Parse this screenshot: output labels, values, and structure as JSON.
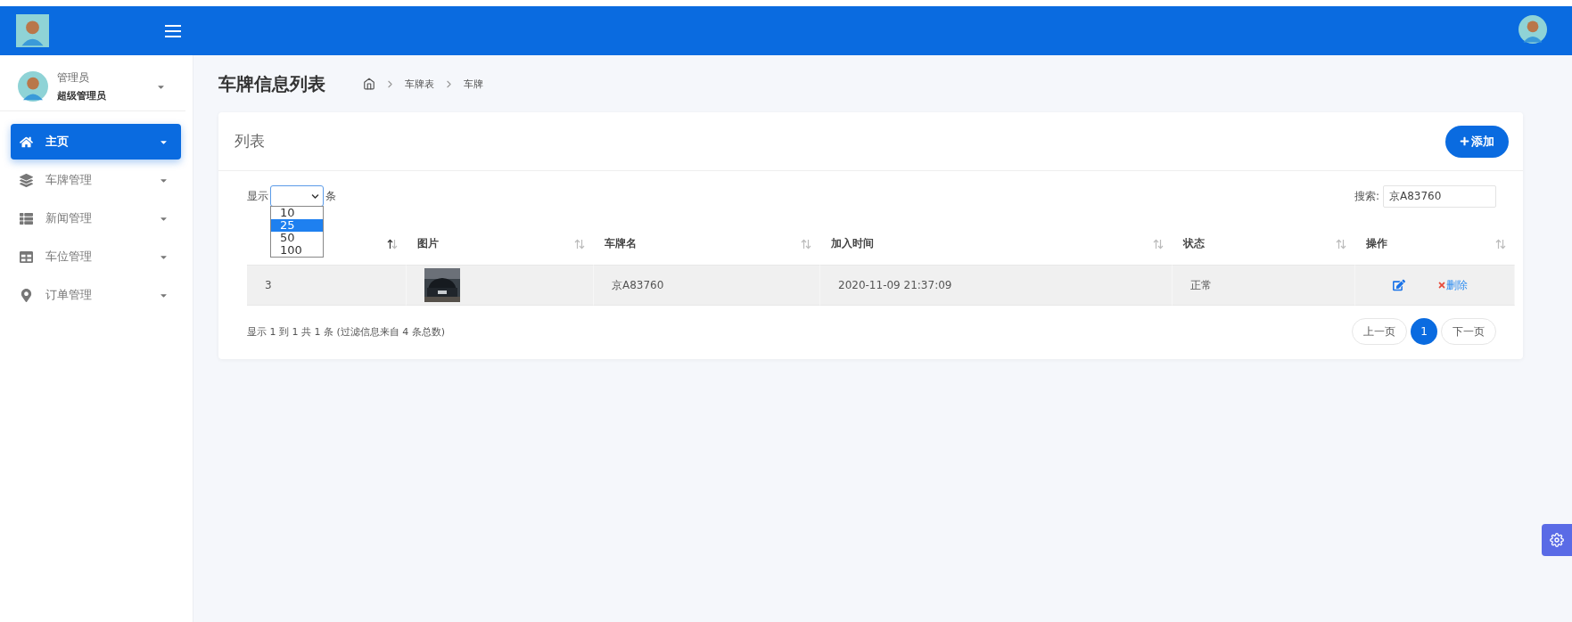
{
  "user": {
    "name": "管理员",
    "role": "超级管理员"
  },
  "menu": [
    {
      "label": "主页",
      "selected": true
    },
    {
      "label": "车牌管理",
      "selected": false
    },
    {
      "label": "新闻管理",
      "selected": false
    },
    {
      "label": "车位管理",
      "selected": false
    },
    {
      "label": "订单管理",
      "selected": false
    }
  ],
  "page_title": "车牌信息列表",
  "breadcrumb": [
    "车牌表",
    "车牌"
  ],
  "card": {
    "title": "列表",
    "add_button": "添加",
    "length": {
      "label_before": "显示",
      "label_after": "条",
      "expanded": true,
      "options": [
        {
          "label": "10",
          "selected": false
        },
        {
          "label": "25",
          "selected": true
        },
        {
          "label": "50",
          "selected": false
        },
        {
          "label": "100",
          "selected": false
        }
      ]
    },
    "search": {
      "label": "搜索:",
      "value": "京A83760"
    },
    "columns": [
      {
        "sorted": true
      },
      {
        "label": "图片",
        "sorted": false
      },
      {
        "label": "车牌名",
        "sorted": false
      },
      {
        "label": "加入时间",
        "sorted": false
      },
      {
        "label": "状态",
        "sorted": false
      },
      {
        "label": "操作",
        "sorted": false
      }
    ],
    "rows": [
      {
        "index": "3",
        "plate": "京A83760",
        "added": "2020-11-09 21:37:09",
        "status": "正常",
        "delete": "删除"
      }
    ],
    "info": "显示 1 到 1 共 1 条 (过滤信息来自 4 条总数)",
    "pagination": {
      "prev": "上一页",
      "pages": [
        {
          "label": "1",
          "selected": true
        }
      ],
      "next": "下一页"
    }
  }
}
